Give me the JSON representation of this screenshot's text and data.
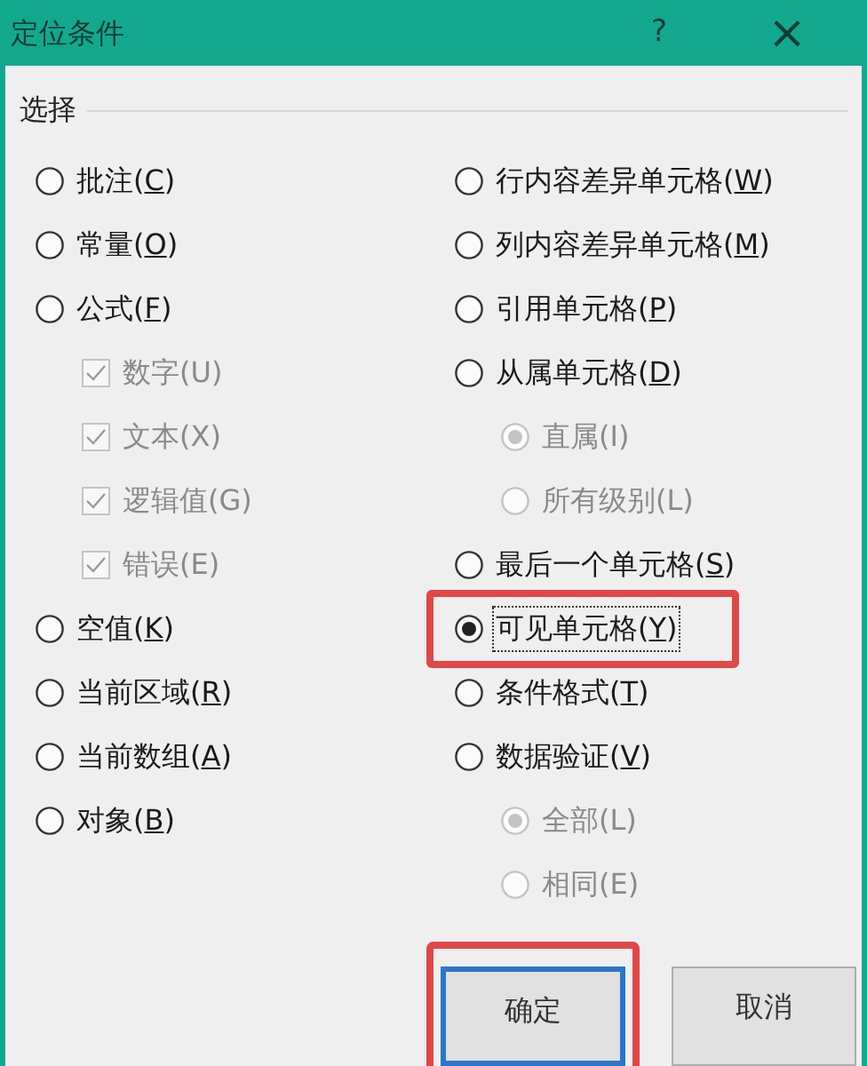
{
  "window": {
    "title": "定位条件",
    "help": "?",
    "close": "×"
  },
  "group": {
    "label": "选择"
  },
  "columns": [
    [
      {
        "kind": "radio",
        "label": "批注(C)",
        "access_key": true,
        "selected": false,
        "disabled": false
      },
      {
        "kind": "radio",
        "label": "常量(O)",
        "access_key": true,
        "selected": false,
        "disabled": false
      },
      {
        "kind": "radio",
        "label": "公式(F)",
        "access_key": true,
        "selected": false,
        "disabled": false,
        "children": [
          {
            "kind": "checkbox",
            "label": "数字(U)",
            "access_key": false,
            "checked": true,
            "disabled": true
          },
          {
            "kind": "checkbox",
            "label": "文本(X)",
            "access_key": false,
            "checked": true,
            "disabled": true
          },
          {
            "kind": "checkbox",
            "label": "逻辑值(G)",
            "access_key": false,
            "checked": true,
            "disabled": true
          },
          {
            "kind": "checkbox",
            "label": "错误(E)",
            "access_key": false,
            "checked": true,
            "disabled": true
          }
        ]
      },
      {
        "kind": "radio",
        "label": "空值(K)",
        "access_key": true,
        "selected": false,
        "disabled": false
      },
      {
        "kind": "radio",
        "label": "当前区域(R)",
        "access_key": true,
        "selected": false,
        "disabled": false
      },
      {
        "kind": "radio",
        "label": "当前数组(A)",
        "access_key": true,
        "selected": false,
        "disabled": false
      },
      {
        "kind": "radio",
        "label": "对象(B)",
        "access_key": true,
        "selected": false,
        "disabled": false
      }
    ],
    [
      {
        "kind": "radio",
        "label": "行内容差异单元格(W)",
        "access_key": true,
        "selected": false,
        "disabled": false
      },
      {
        "kind": "radio",
        "label": "列内容差异单元格(M)",
        "access_key": true,
        "selected": false,
        "disabled": false
      },
      {
        "kind": "radio",
        "label": "引用单元格(P)",
        "access_key": true,
        "selected": false,
        "disabled": false
      },
      {
        "kind": "radio",
        "label": "从属单元格(D)",
        "access_key": true,
        "selected": false,
        "disabled": false,
        "children": [
          {
            "kind": "radio",
            "label": "直属(I)",
            "access_key": false,
            "selected": true,
            "disabled": true
          },
          {
            "kind": "radio",
            "label": "所有级别(L)",
            "access_key": false,
            "selected": false,
            "disabled": true
          }
        ]
      },
      {
        "kind": "radio",
        "label": "最后一个单元格(S)",
        "access_key": true,
        "selected": false,
        "disabled": false
      },
      {
        "kind": "radio",
        "label": "可见单元格(Y)",
        "access_key": true,
        "selected": true,
        "disabled": false,
        "focused": true,
        "highlighted": true
      },
      {
        "kind": "radio",
        "label": "条件格式(T)",
        "access_key": true,
        "selected": false,
        "disabled": false
      },
      {
        "kind": "radio",
        "label": "数据验证(V)",
        "access_key": true,
        "selected": false,
        "disabled": false,
        "children": [
          {
            "kind": "radio",
            "label": "全部(L)",
            "access_key": false,
            "selected": true,
            "disabled": true
          },
          {
            "kind": "radio",
            "label": "相同(E)",
            "access_key": false,
            "selected": false,
            "disabled": true
          }
        ]
      }
    ]
  ],
  "buttons": [
    {
      "label": "确定",
      "default": true,
      "highlighted": true
    },
    {
      "label": "取消",
      "default": false,
      "highlighted": false
    }
  ]
}
